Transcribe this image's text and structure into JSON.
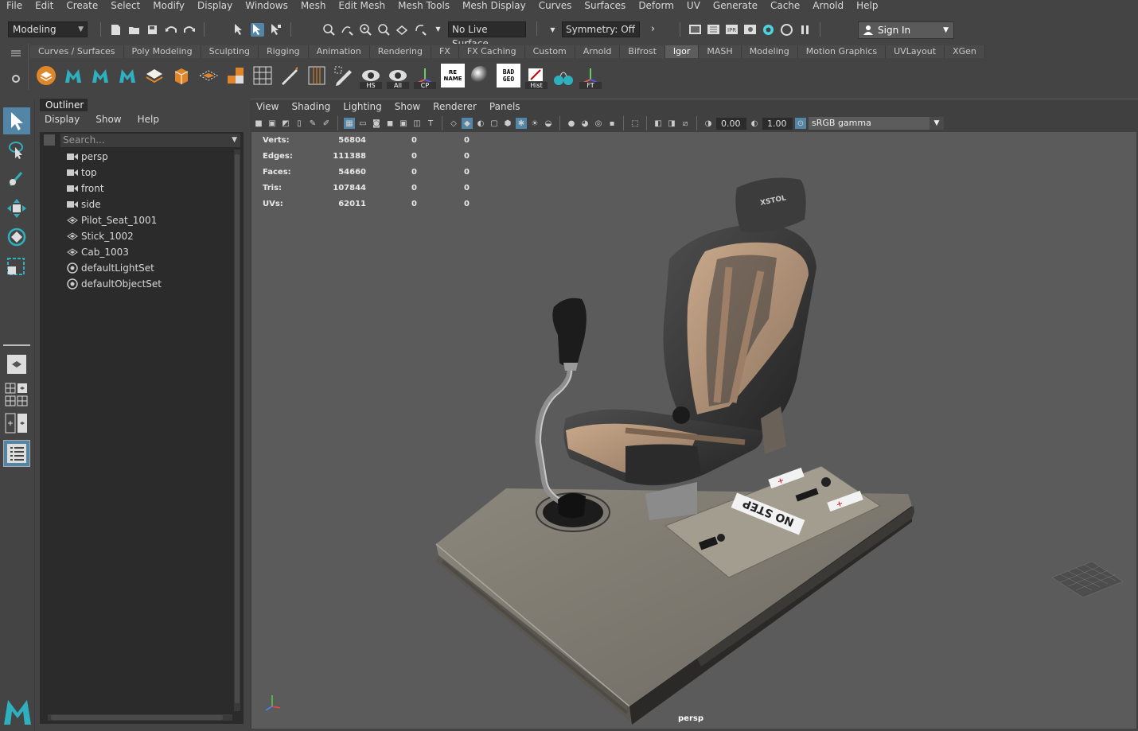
{
  "menubar": [
    "File",
    "Edit",
    "Create",
    "Select",
    "Modify",
    "Display",
    "Windows",
    "Mesh",
    "Edit Mesh",
    "Mesh Tools",
    "Mesh Display",
    "Curves",
    "Surfaces",
    "Deform",
    "UV",
    "Generate",
    "Cache",
    "Arnold",
    "Help"
  ],
  "status": {
    "mode": "Modeling",
    "live_surface": "No Live Surface",
    "symmetry": "Symmetry: Off",
    "sign_in": "Sign In"
  },
  "shelf": {
    "tabs": [
      "Curves / Surfaces",
      "Poly Modeling",
      "Sculpting",
      "Rigging",
      "Animation",
      "Rendering",
      "FX",
      "FX Caching",
      "Custom",
      "Arnold",
      "Bifrost",
      "Igor",
      "MASH",
      "Modeling",
      "Motion Graphics",
      "UVLayout",
      "XGen"
    ],
    "active_tab": "Igor",
    "icon_labels": {
      "hs": "HS",
      "all": "All",
      "cp": "CP",
      "rename": "RE NAME",
      "badgeo": "BAD GEO",
      "hist": "Hist",
      "ft": "FT"
    }
  },
  "outliner": {
    "tab": "Outliner",
    "menu": [
      "Display",
      "Show",
      "Help"
    ],
    "search_placeholder": "Search...",
    "items": [
      {
        "label": "persp",
        "icon": "camera-icon"
      },
      {
        "label": "top",
        "icon": "camera-icon"
      },
      {
        "label": "front",
        "icon": "camera-icon"
      },
      {
        "label": "side",
        "icon": "camera-icon"
      },
      {
        "label": "Pilot_Seat_1001",
        "icon": "mesh-icon"
      },
      {
        "label": "Stick_1002",
        "icon": "mesh-icon"
      },
      {
        "label": "Cab_1003",
        "icon": "mesh-icon"
      },
      {
        "label": "defaultLightSet",
        "icon": "set-icon"
      },
      {
        "label": "defaultObjectSet",
        "icon": "set-icon"
      }
    ]
  },
  "viewport": {
    "menu": [
      "View",
      "Shading",
      "Lighting",
      "Show",
      "Renderer",
      "Panels"
    ],
    "exposure": "0.00",
    "gamma": "1.00",
    "color_space": "sRGB gamma",
    "camera": "persp",
    "hud": [
      {
        "k": "Verts:",
        "a": "56804",
        "b": "0",
        "c": "0"
      },
      {
        "k": "Edges:",
        "a": "111388",
        "b": "0",
        "c": "0"
      },
      {
        "k": "Faces:",
        "a": "54660",
        "b": "0",
        "c": "0"
      },
      {
        "k": "Tris:",
        "a": "107844",
        "b": "0",
        "c": "0"
      },
      {
        "k": "UVs:",
        "a": "62011",
        "b": "0",
        "c": "0"
      }
    ],
    "decals": {
      "no_step": "NO STEP",
      "brand": "XSTOL"
    }
  },
  "colors": {
    "accent": "#5285a6",
    "bg": "#444444",
    "viewport_bg": "#5b5b5b",
    "panel": "#2b2b2b"
  }
}
